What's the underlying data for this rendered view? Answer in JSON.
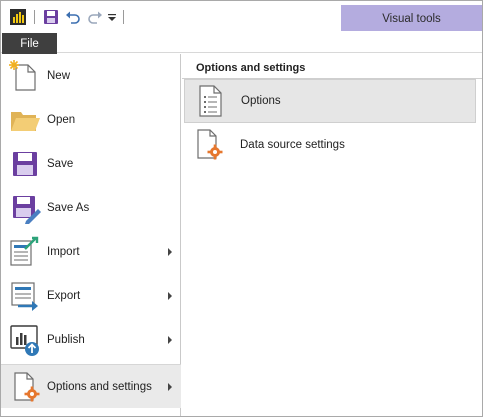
{
  "quick_access": {
    "icons": [
      "powerbi-logo-icon",
      "save-icon",
      "undo-icon",
      "redo-icon",
      "customize-dropdown-icon"
    ]
  },
  "contextual_tab": {
    "label": "Visual tools"
  },
  "file_tab": {
    "label": "File"
  },
  "menu": {
    "items": [
      {
        "label": "New",
        "icon": "new-icon",
        "has_submenu": false
      },
      {
        "label": "Open",
        "icon": "open-folder-icon",
        "has_submenu": false
      },
      {
        "label": "Save",
        "icon": "save-icon",
        "has_submenu": false
      },
      {
        "label": "Save As",
        "icon": "save-as-icon",
        "has_submenu": false
      },
      {
        "label": "Import",
        "icon": "import-icon",
        "has_submenu": true
      },
      {
        "label": "Export",
        "icon": "export-icon",
        "has_submenu": true
      },
      {
        "label": "Publish",
        "icon": "publish-icon",
        "has_submenu": true
      },
      {
        "label": "Options and settings",
        "icon": "options-settings-icon",
        "has_submenu": true,
        "selected": true
      }
    ]
  },
  "submenu": {
    "header": "Options and settings",
    "items": [
      {
        "label": "Options",
        "icon": "options-document-icon",
        "selected": true
      },
      {
        "label": "Data source settings",
        "icon": "data-source-settings-icon",
        "selected": false
      }
    ]
  },
  "colors": {
    "accent_purple": "#b4acdf",
    "file_tab_bg": "#3f3f3f",
    "powerbi_yellow": "#f2c811",
    "settings_orange": "#e6772e",
    "save_purple": "#6b3fa0"
  }
}
